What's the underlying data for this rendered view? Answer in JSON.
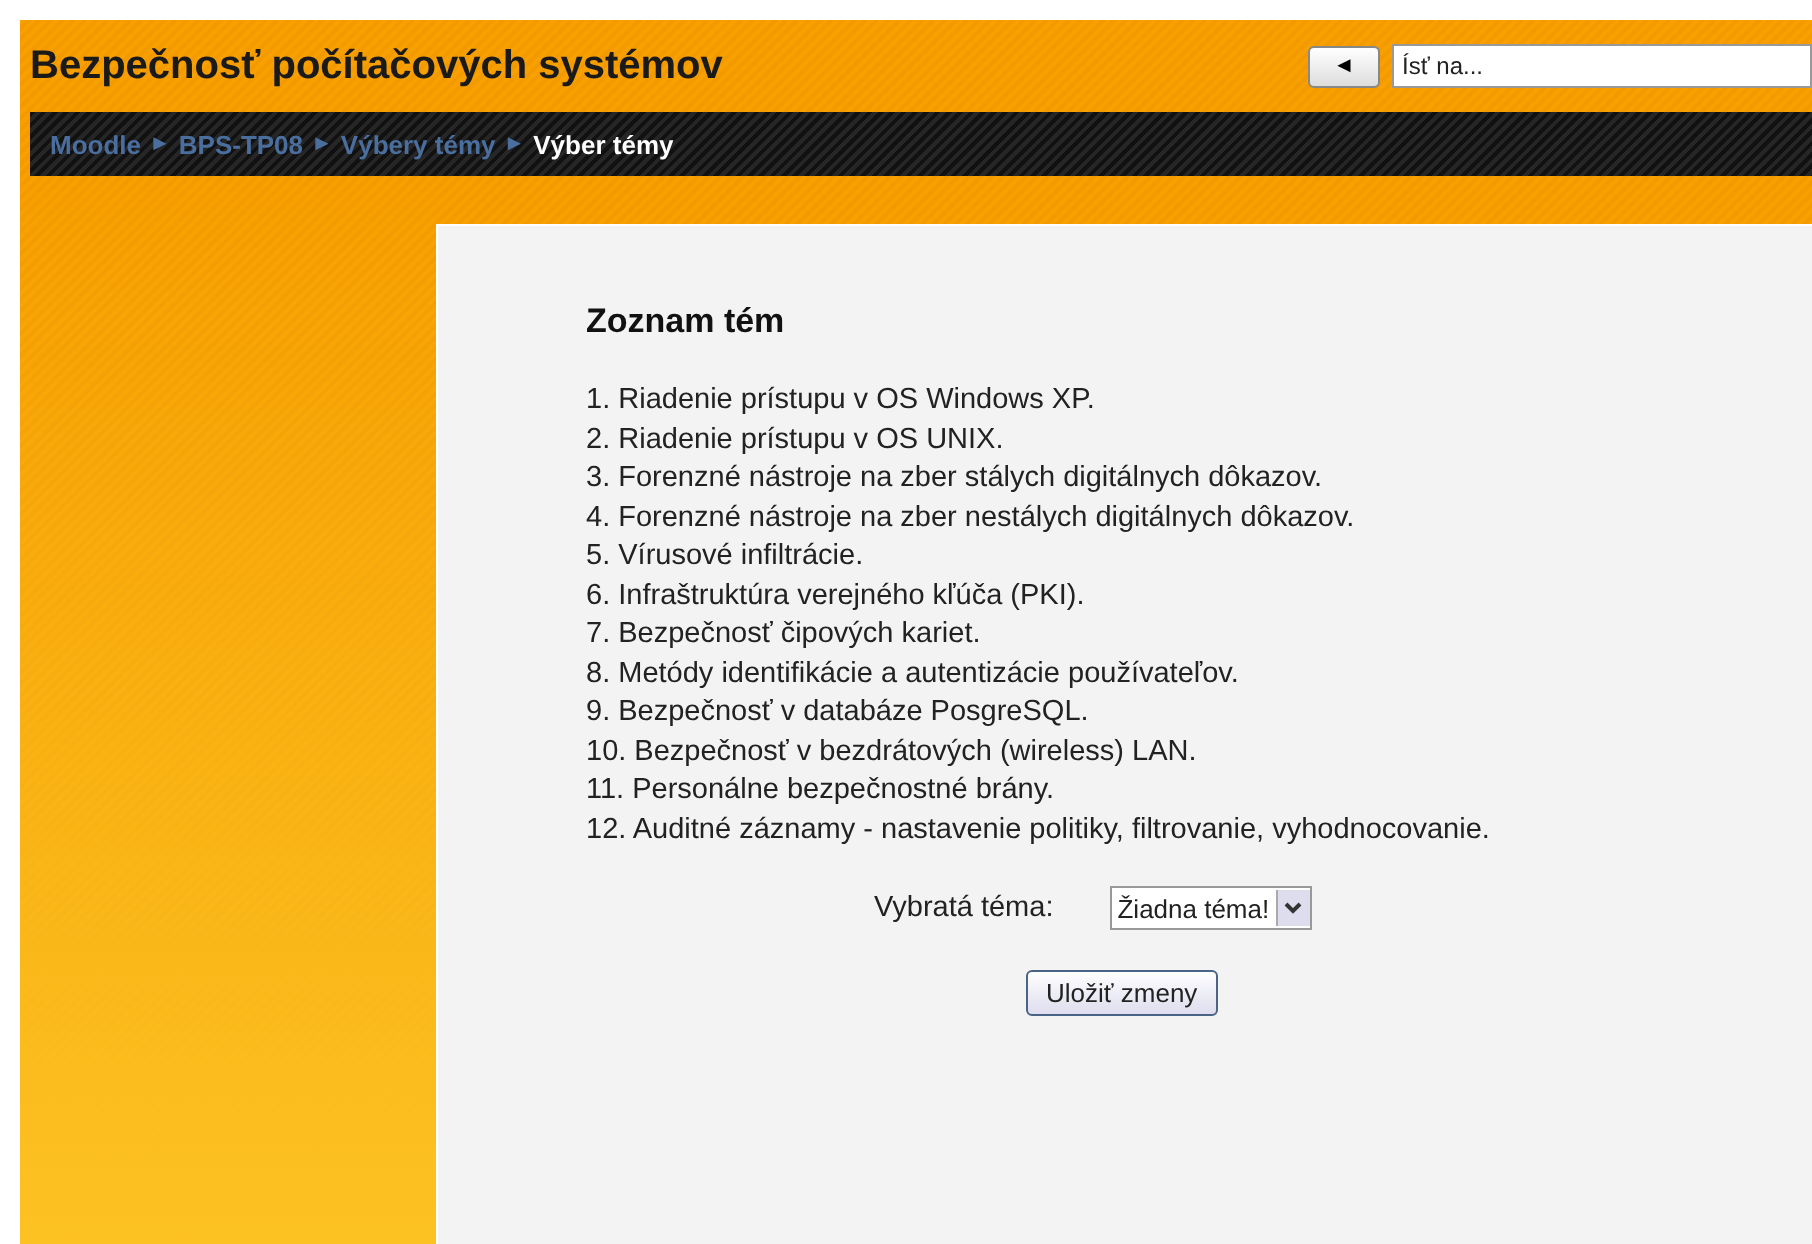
{
  "header": {
    "title": "Bezpečnosť počítačových systémov",
    "jump": {
      "back": "◄",
      "placeholder": "Ísť na..."
    }
  },
  "breadcrumb": [
    {
      "label": "Moodle",
      "current": false
    },
    {
      "label": "BPS-TP08",
      "current": false
    },
    {
      "label": "Výbery témy",
      "current": false
    },
    {
      "label": "Výber témy",
      "current": true
    }
  ],
  "separator": "►",
  "content": {
    "heading": "Zoznam tém",
    "topics": [
      "1. Riadenie prístupu v OS Windows XP.",
      "2. Riadenie prístupu v OS UNIX.",
      "3. Forenzné nástroje na zber stálych digitálnych dôkazov.",
      "4. Forenzné nástroje na zber nestálych digitálnych dôkazov.",
      "5. Vírusové infiltrácie.",
      "6. Infraštruktúra verejného kľúča (PKI).",
      "7. Bezpečnosť čipových kariet.",
      "8. Metódy identifikácie a autentizácie používateľov.",
      "9. Bezpečnosť v databáze PosgreSQL.",
      "10. Bezpečnosť v bezdrátových (wireless) LAN.",
      "11. Personálne bezpečnostné brány.",
      "12. Auditné záznamy - nastavenie politiky, filtrovanie, vyhodnocovanie."
    ],
    "select_label": "Vybratá téma:",
    "select_value": "Žiadna téma!",
    "save": "Uložiť zmeny"
  }
}
